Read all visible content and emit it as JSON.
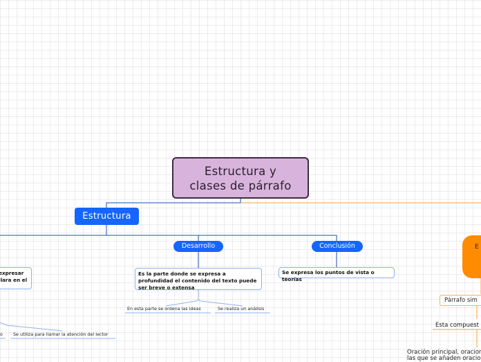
{
  "colors": {
    "root_fill": "#d8b4dc",
    "main_blue": "#1565ff",
    "orange": "#ff8c00",
    "connector_blue": "#1b4fb8",
    "connector_orange": "#f0a040"
  },
  "root": {
    "line1": "Estructura y",
    "line2": "clases de párrafo"
  },
  "estructura": {
    "label": "Estructura",
    "left_text_line1": "expresar",
    "left_text_line2": "llara en el",
    "desarrollo": {
      "label": "Desarrollo",
      "text": "Es la parte donde se expresa a profundidad el contenido del texto puede ser breve o extensa",
      "leaves": [
        "En esta parte se ordena las ideas",
        "Se realiza un análisis"
      ]
    },
    "conclusion": {
      "label": "Conclusión",
      "text": "Se expresa los puntos de vista o teorías"
    },
    "bottom_leaves": [
      "o",
      "Se utiliza para llamar la atención del lector"
    ]
  },
  "right_branch": {
    "orange_label": "E",
    "parrafo_simple": "Párrafo sim",
    "compuesto": "Esta compuest",
    "oracion_line1": "Oración principal, oracion",
    "oracion_line2": "las que se añaden oracion"
  }
}
